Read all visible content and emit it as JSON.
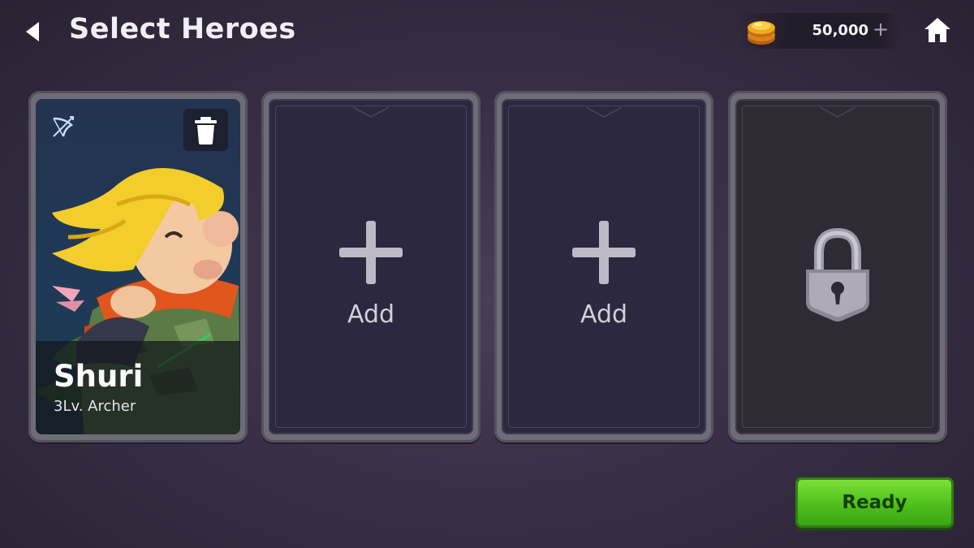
{
  "header": {
    "title": "Select Heroes",
    "back_icon": "back-arrow-icon",
    "home_icon": "home-icon"
  },
  "currency": {
    "icon": "gold-coin-icon",
    "amount": "50,000",
    "add_symbol": "+"
  },
  "slots": [
    {
      "state": "filled",
      "hero_name": "Shuri",
      "hero_subtitle": "3Lv. Archer",
      "class_icon": "bow-icon",
      "remove_icon": "trash-icon"
    },
    {
      "state": "empty",
      "label": "Add",
      "icon": "plus-icon"
    },
    {
      "state": "empty",
      "label": "Add",
      "icon": "plus-icon"
    },
    {
      "state": "locked",
      "icon": "padlock-icon"
    }
  ],
  "actions": {
    "ready_label": "Ready"
  },
  "colors": {
    "background": "#3a2f47",
    "slot_bg": "#2b2840",
    "ready_green": "#4fbf1c",
    "frame": "#6f6c78"
  }
}
